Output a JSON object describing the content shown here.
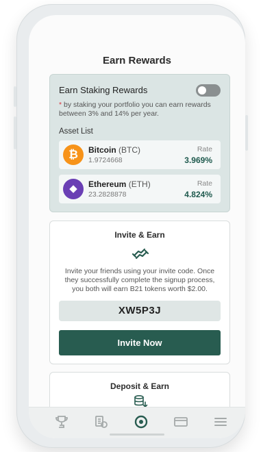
{
  "header": {
    "title": "Earn Rewards"
  },
  "staking": {
    "title": "Earn Staking Rewards",
    "toggle_on": false,
    "note_marker": "*",
    "note": "by staking your portfolio you can earn rewards between 3% and 14% per year.",
    "asset_list_label": "Asset List",
    "assets": [
      {
        "name": "Bitcoin",
        "symbol": "(BTC)",
        "amount": "1.9724668",
        "rate_label": "Rate",
        "rate": "3.969%",
        "icon": "bitcoin-icon",
        "color": "#f7931a",
        "glyph": "₿"
      },
      {
        "name": "Ethereum",
        "symbol": "(ETH)",
        "amount": "23.2828878",
        "rate_label": "Rate",
        "rate": "4.824%",
        "icon": "ethereum-icon",
        "color": "#6a3fb4",
        "glyph": "◆"
      }
    ]
  },
  "invite": {
    "title": "Invite & Earn",
    "icon": "handshake-icon",
    "text": "Invite your friends using your invite code. Once they successfully complete the signup process, you both will earn B21 tokens worth $2.00.",
    "code": "XW5P3J",
    "button_label": "Invite Now"
  },
  "deposit": {
    "title": "Deposit & Earn",
    "icon": "coin-stack-icon"
  },
  "tabbar": {
    "tabs": [
      "trophy-icon",
      "coins-icon",
      "earn-icon",
      "card-icon",
      "menu-icon"
    ],
    "active": "earn-icon"
  },
  "colors": {
    "accent": "#285c50",
    "stake_card_bg": "#dbe5e4",
    "rate": "#1f5a4e"
  }
}
